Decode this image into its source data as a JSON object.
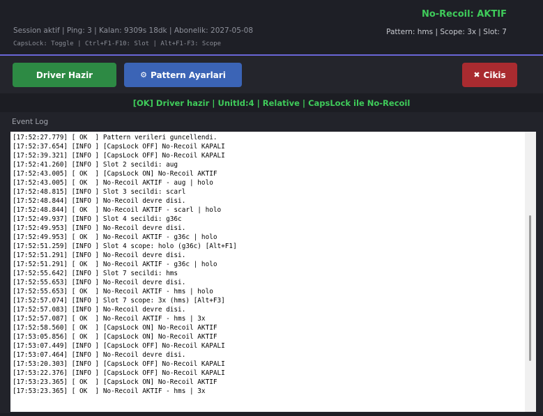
{
  "header": {
    "status_title": "No-Recoil: AKTIF",
    "session_line": "Session aktif | Ping: 3 | Kalan: 9309s 18dk | Abonelik: 2027-05-08",
    "pattern_line": "Pattern: hms | Scope: 3x | Slot: 7",
    "hotkeys_line": "CapsLock: Toggle | Ctrl+F1-F10: Slot | Alt+F1-F3: Scope"
  },
  "toolbar": {
    "driver_label": "Driver Hazir",
    "pattern_label": "Pattern  Ayarlari",
    "pattern_icon": "⚙",
    "exit_label": "Cikis",
    "exit_icon": "✖"
  },
  "status_message": "[OK] Driver hazir | UnitId:4 | Relative | CapsLock ile No-Recoil",
  "event_log": {
    "title": "Event Log",
    "scroll_position": 0.62,
    "scroll_visible_fraction": 0.52,
    "lines": [
      "[17:52:27.779] [ OK  ] Pattern verileri guncellendi.",
      "[17:52:37.654] [INFO ] [CapsLock OFF] No-Recoil KAPALI",
      "[17:52:39.321] [INFO ] [CapsLock OFF] No-Recoil KAPALI",
      "[17:52:41.260] [INFO ] Slot 2 secildi: aug",
      "[17:52:43.005] [ OK  ] [CapsLock ON] No-Recoil AKTIF",
      "[17:52:43.005] [ OK  ] No-Recoil AKTIF - aug | holo",
      "[17:52:48.815] [INFO ] Slot 3 secildi: scarl",
      "[17:52:48.844] [INFO ] No-Recoil devre disi.",
      "[17:52:48.844] [ OK  ] No-Recoil AKTIF - scarl | holo",
      "[17:52:49.937] [INFO ] Slot 4 secildi: g36c",
      "[17:52:49.953] [INFO ] No-Recoil devre disi.",
      "[17:52:49.953] [ OK  ] No-Recoil AKTIF - g36c | holo",
      "[17:52:51.259] [INFO ] Slot 4 scope: holo (g36c) [Alt+F1]",
      "[17:52:51.291] [INFO ] No-Recoil devre disi.",
      "[17:52:51.291] [ OK  ] No-Recoil AKTIF - g36c | holo",
      "[17:52:55.642] [INFO ] Slot 7 secildi: hms",
      "[17:52:55.653] [INFO ] No-Recoil devre disi.",
      "[17:52:55.653] [ OK  ] No-Recoil AKTIF - hms | holo",
      "[17:52:57.074] [INFO ] Slot 7 scope: 3x (hms) [Alt+F3]",
      "[17:52:57.083] [INFO ] No-Recoil devre disi.",
      "[17:52:57.087] [ OK  ] No-Recoil AKTIF - hms | 3x",
      "[17:52:58.560] [ OK  ] [CapsLock ON] No-Recoil AKTIF",
      "[17:53:05.856] [ OK  ] [CapsLock ON] No-Recoil AKTIF",
      "[17:53:07.449] [INFO ] [CapsLock OFF] No-Recoil KAPALI",
      "[17:53:07.464] [INFO ] No-Recoil devre disi.",
      "[17:53:20.303] [INFO ] [CapsLock OFF] No-Recoil KAPALI",
      "[17:53:22.376] [INFO ] [CapsLock OFF] No-Recoil KAPALI",
      "[17:53:23.365] [ OK  ] [CapsLock ON] No-Recoil AKTIF",
      "[17:53:23.365] [ OK  ] No-Recoil AKTIF - hms | 3x"
    ]
  },
  "colors": {
    "accent_green": "#3fcb5a",
    "header_rule": "#6a66d8",
    "driver_button": "#2d8a44",
    "pattern_button": "#3b64b6",
    "exit_button": "#a92b30"
  }
}
